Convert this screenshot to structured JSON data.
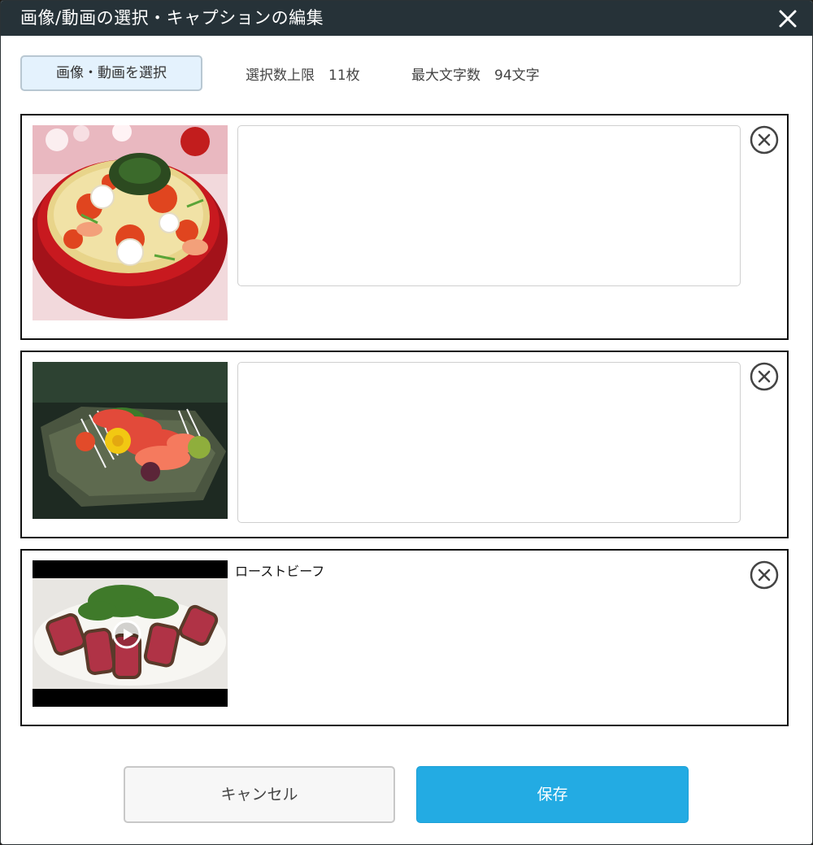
{
  "dialog": {
    "title": "画像/動画の選択・キャプションの編集",
    "close_icon": "close-icon"
  },
  "toolbar": {
    "select_label": "画像・動画を選択",
    "limit_label": "選択数上限　11枚",
    "max_chars_label": "最大文字数　94文字"
  },
  "items": [
    {
      "kind": "image",
      "subject": "chirashi-sushi-bowl",
      "caption": "",
      "remove_icon": "circle-x-icon"
    },
    {
      "kind": "image",
      "subject": "sashimi-plate",
      "caption": "",
      "remove_icon": "circle-x-icon"
    },
    {
      "kind": "video",
      "subject": "seared-beef-salad",
      "caption": "ローストビーフ",
      "play_icon": "play-icon",
      "remove_icon": "circle-x-icon"
    }
  ],
  "footer": {
    "cancel_label": "キャンセル",
    "save_label": "保存"
  },
  "colors": {
    "titlebar": "#263238",
    "save_button": "#23abe3",
    "select_button_bg": "#e4f2fd"
  }
}
